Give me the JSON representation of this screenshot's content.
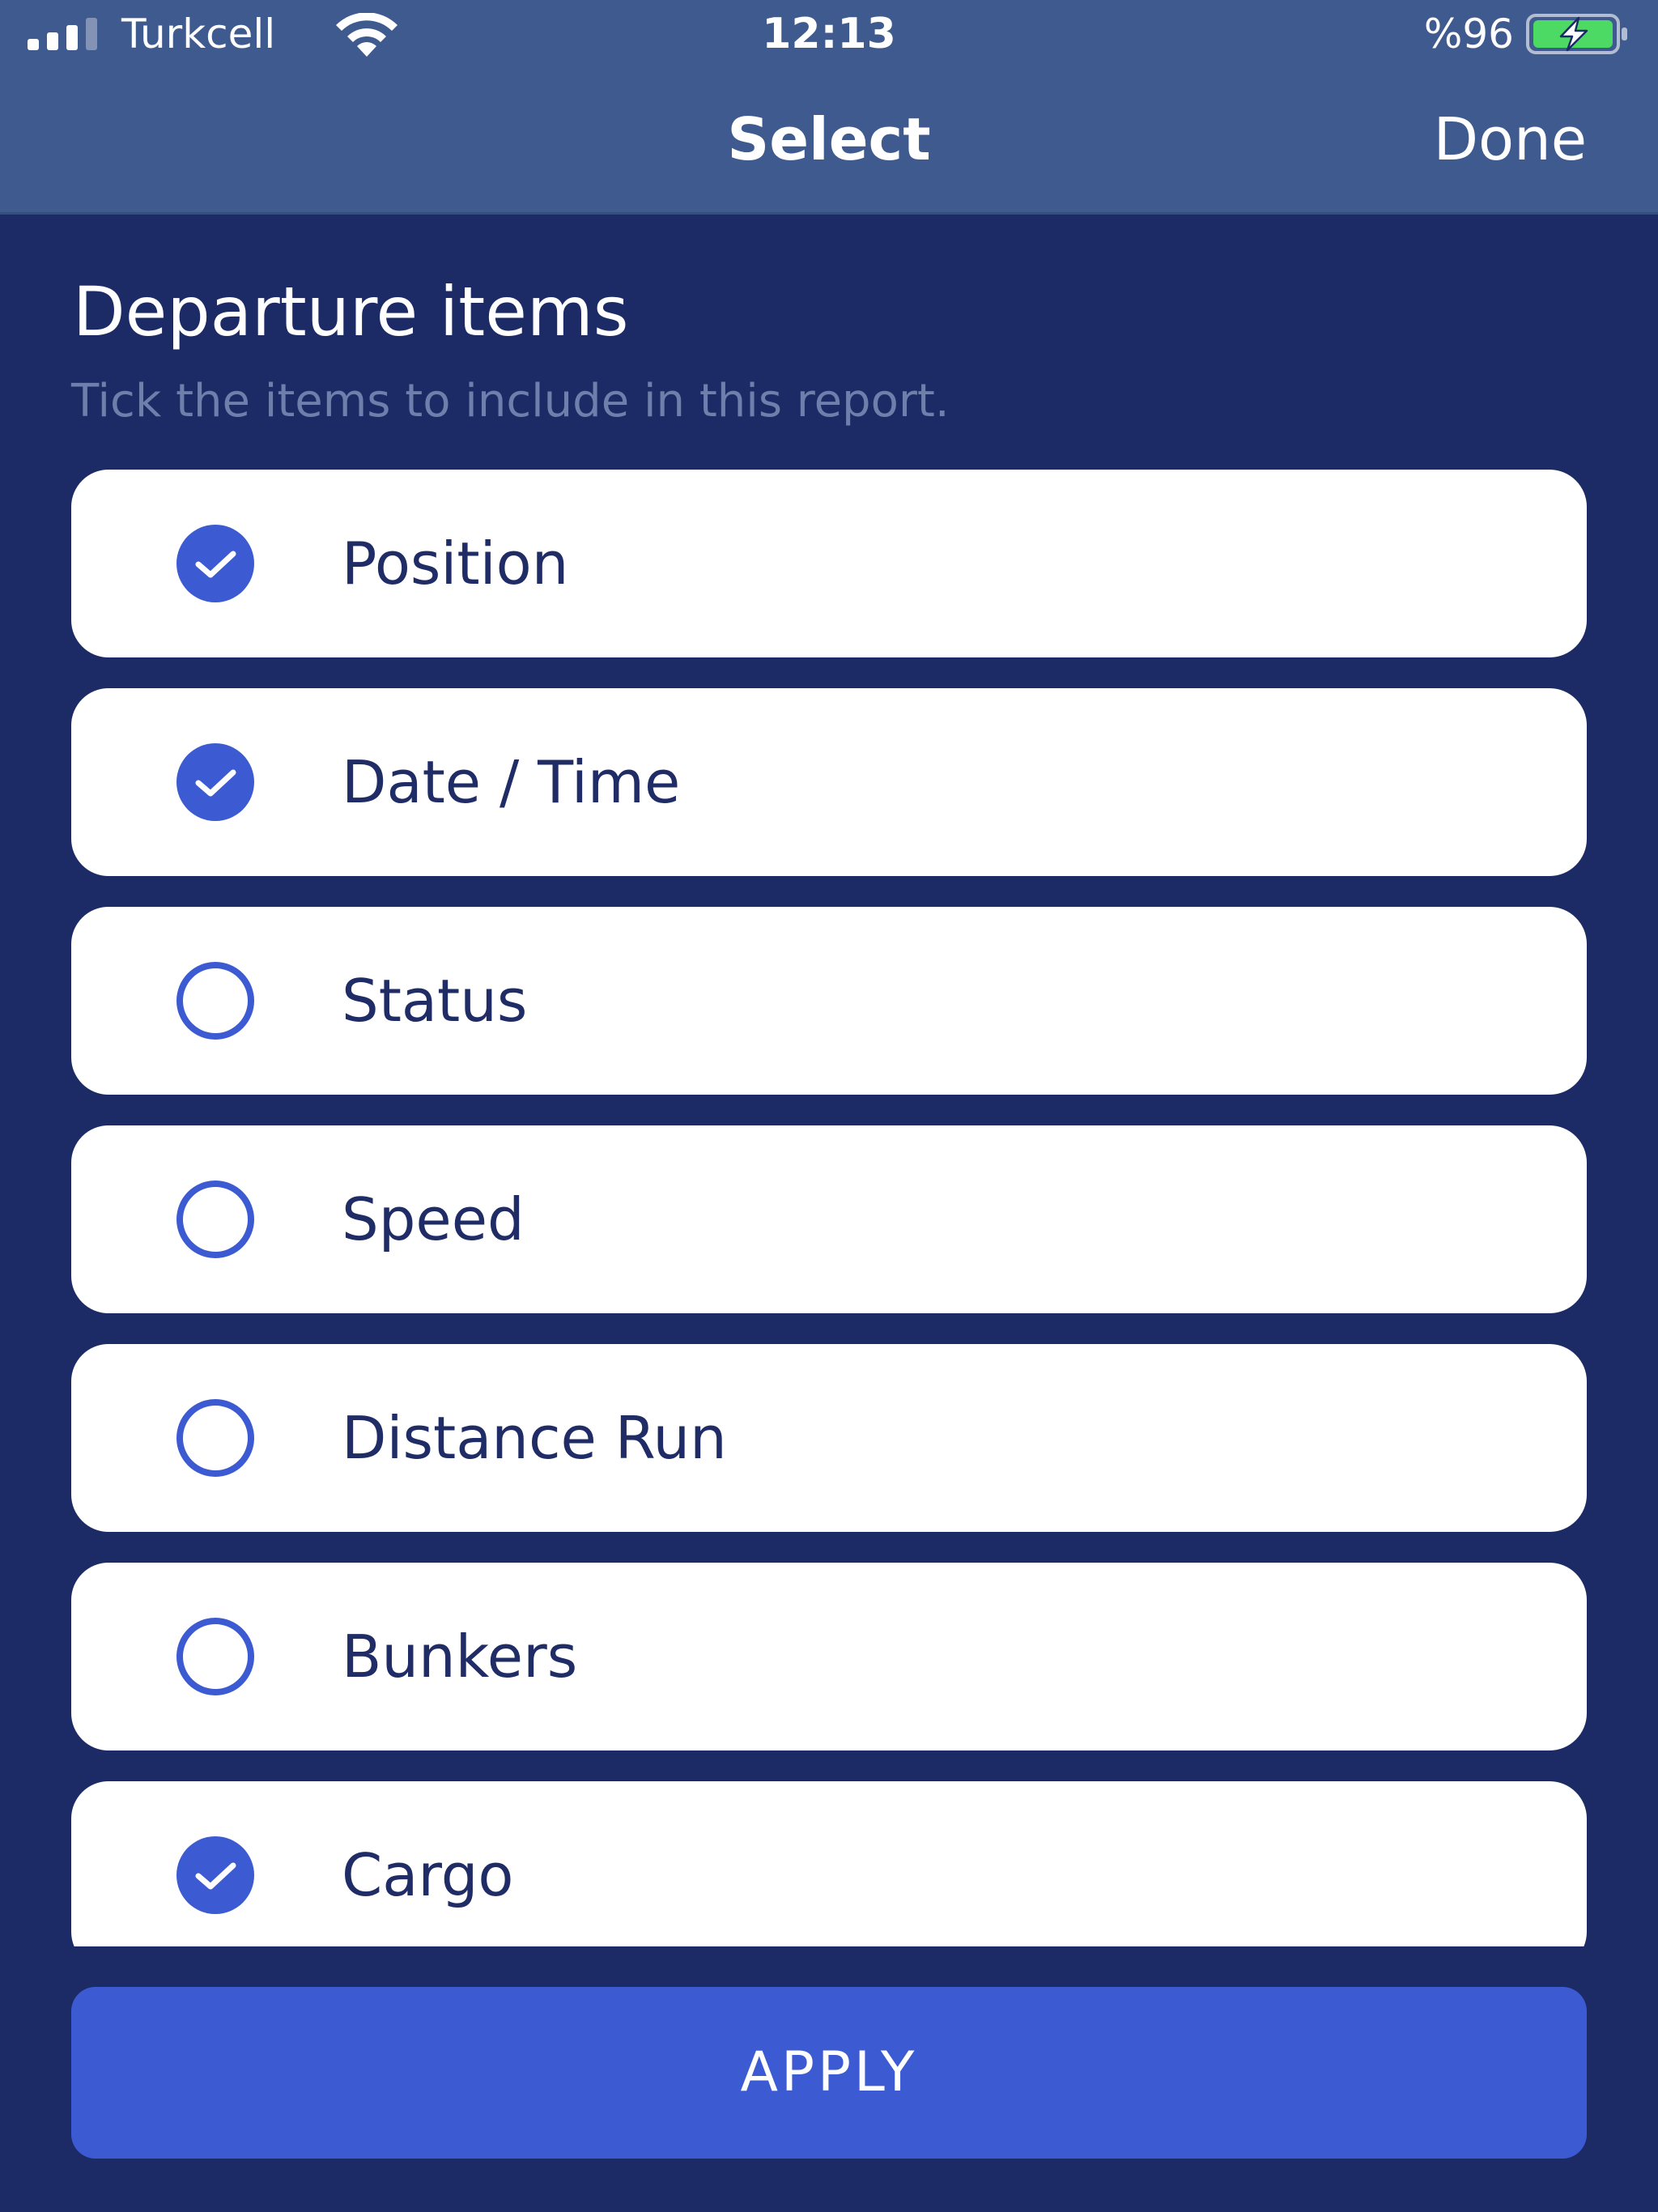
{
  "status_bar": {
    "carrier": "Turkcell",
    "time": "12:13",
    "battery_percent": "%96",
    "battery_charging": true,
    "icons": [
      "signal-icon",
      "wifi-icon",
      "battery-charging-icon"
    ]
  },
  "nav": {
    "title": "Select",
    "done_label": "Done"
  },
  "section": {
    "title": "Departure items",
    "subtitle": "Tick the items to include in this report."
  },
  "items": [
    {
      "label": "Position",
      "checked": true
    },
    {
      "label": "Date / Time",
      "checked": true
    },
    {
      "label": "Status",
      "checked": false
    },
    {
      "label": "Speed",
      "checked": false
    },
    {
      "label": "Distance Run",
      "checked": false
    },
    {
      "label": "Bunkers",
      "checked": false
    },
    {
      "label": "Cargo",
      "checked": true
    }
  ],
  "apply_label": "APPLY",
  "colors": {
    "background": "#1c2b66",
    "header": "#3f5a8f",
    "accent": "#3c5bd3",
    "item_text": "#1f2c66",
    "subtitle": "#6f7fab",
    "battery_green": "#4cd964"
  }
}
